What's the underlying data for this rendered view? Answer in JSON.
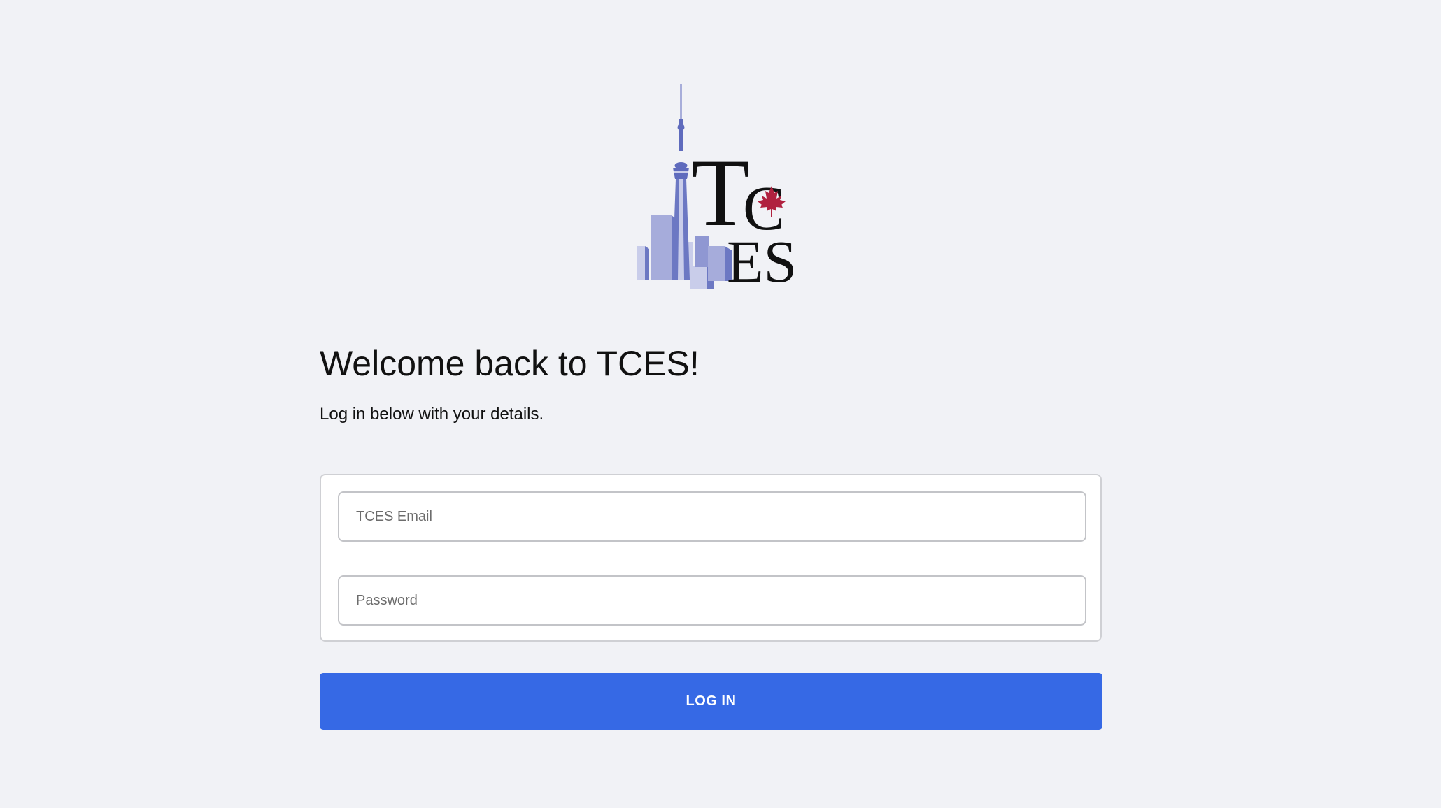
{
  "logo": {
    "icon": "cn-tower-skyline-icon",
    "mark": "TCES",
    "accent_color": "#b0213f",
    "skyline_color": "#6f7ac6"
  },
  "welcome": {
    "title": "Welcome back to TCES!",
    "subtitle": "Log in below with your details."
  },
  "form": {
    "email_placeholder": "TCES Email",
    "email_value": "",
    "password_placeholder": "Password",
    "password_value": "",
    "submit_label": "LOG IN"
  },
  "colors": {
    "background": "#f1f2f6",
    "primary_button": "#3669e5"
  }
}
